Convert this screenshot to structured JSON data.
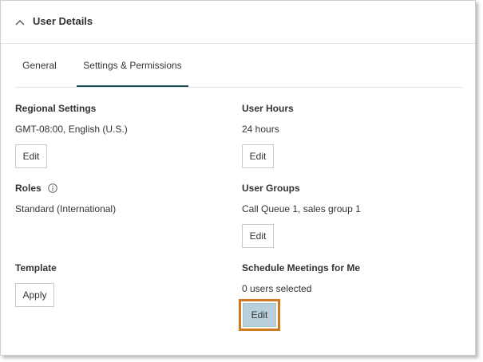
{
  "header": {
    "title": "User Details"
  },
  "tabs": [
    {
      "label": "General",
      "active": false
    },
    {
      "label": "Settings & Permissions",
      "active": true
    }
  ],
  "sections": {
    "regional_settings": {
      "title": "Regional Settings",
      "value": "GMT-08:00, English (U.S.)",
      "button": "Edit"
    },
    "user_hours": {
      "title": "User Hours",
      "value": "24 hours",
      "button": "Edit"
    },
    "roles": {
      "title": "Roles",
      "value": "Standard (International)",
      "icon": "info-icon"
    },
    "user_groups": {
      "title": "User Groups",
      "value": "Call Queue 1, sales group 1",
      "button": "Edit"
    },
    "template": {
      "title": "Template",
      "button": "Apply"
    },
    "schedule_meetings": {
      "title": "Schedule Meetings for Me",
      "value": "0 users selected",
      "button": "Edit"
    }
  },
  "colors": {
    "active_tab_underline": "#1f4e5a",
    "highlight_border": "#d1781f",
    "highlight_button_bg": "#b7d0dc"
  }
}
